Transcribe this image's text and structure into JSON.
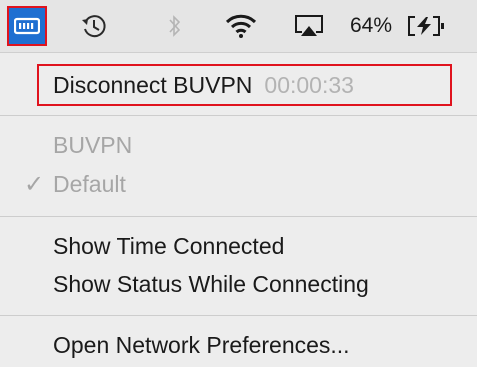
{
  "menubar": {
    "vpn_icon": "vpn-status-icon",
    "history_icon": "time-machine-icon",
    "bluetooth_icon": "bluetooth-icon",
    "wifi_icon": "wifi-icon",
    "airplay_icon": "airplay-icon",
    "battery_percent": "64%",
    "battery_icon": "battery-charging-icon",
    "highlight_color": "#e0131e",
    "selected_color": "#1f6fd1"
  },
  "menu": {
    "disconnect_label": "Disconnect BUVPN",
    "disconnect_timer": "00:00:33",
    "vpn_name": "BUVPN",
    "config_label": "Default",
    "config_checked": true,
    "show_time_label": "Show Time Connected",
    "show_status_label": "Show Status While Connecting",
    "open_prefs_label": "Open Network Preferences..."
  }
}
